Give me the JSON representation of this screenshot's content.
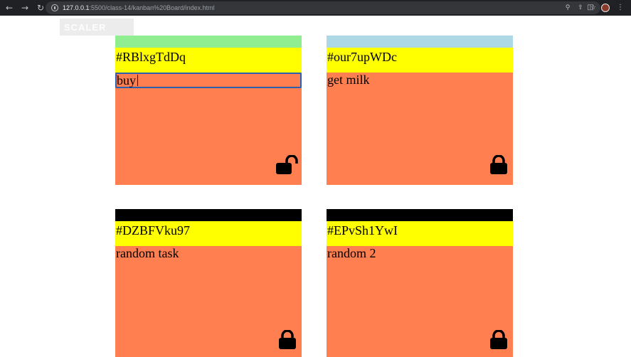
{
  "browser": {
    "url_host": "127.0.0.1",
    "url_path": ":5500/class-14/kanban%20Board/index.html"
  },
  "watermark": "SCALER",
  "tickets": [
    {
      "strip_color": "#90ee90",
      "id": "#RBlxgTdDq",
      "task": "buy ",
      "editing": true,
      "lock": "unlocked"
    },
    {
      "strip_color": "#add8e6",
      "id": "#our7upWDc",
      "task": "get milk",
      "editing": false,
      "lock": "locked"
    },
    {
      "strip_color": "#000000",
      "id": "#DZBFVku97",
      "task": "random task",
      "editing": false,
      "lock": "locked"
    },
    {
      "strip_color": "#000000",
      "id": "#EPvSh1YwI",
      "task": "random 2",
      "editing": false,
      "lock": "locked"
    }
  ],
  "colors": {
    "ticket_bg": "#ff7f50",
    "id_bg": "#ffff00",
    "focus_outline": "#2b5fb0"
  }
}
